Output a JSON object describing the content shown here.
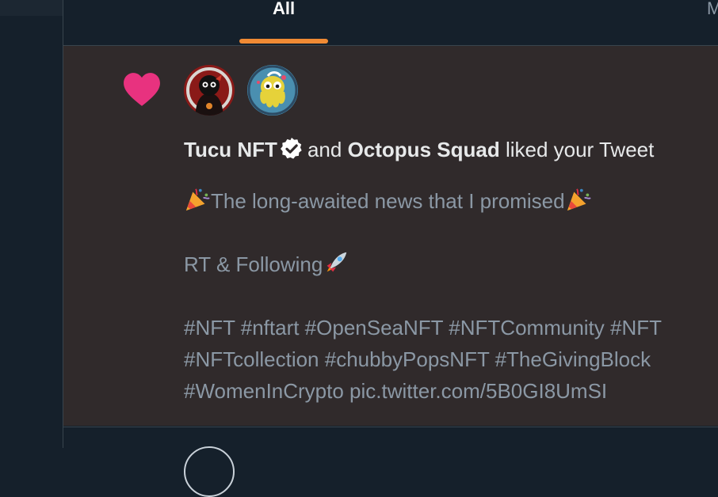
{
  "tabs": {
    "all_label": "All",
    "next_label": "M",
    "active_color": "#f08a34"
  },
  "notification": {
    "type_icon": "heart-icon",
    "heart_color": "#e8327f",
    "avatars": [
      {
        "name": "tucu-nft-avatar"
      },
      {
        "name": "octopus-squad-avatar"
      }
    ],
    "user1": "Tucu NFT",
    "user1_verified": true,
    "and_text": "and",
    "user2": "Octopus Squad",
    "action_text": "liked your Tweet",
    "tweet": {
      "line1": "The long-awaited news that I promised",
      "line2": "RT & Following",
      "line3": "#NFT #nftart #OpenSeaNFT #NFTCommunity #NFT",
      "line4": "#NFTcollection #chubbyPopsNFT  #TheGivingBlock",
      "line5": "#WomenInCrypto pic.twitter.com/5B0GI8UmSI"
    }
  }
}
